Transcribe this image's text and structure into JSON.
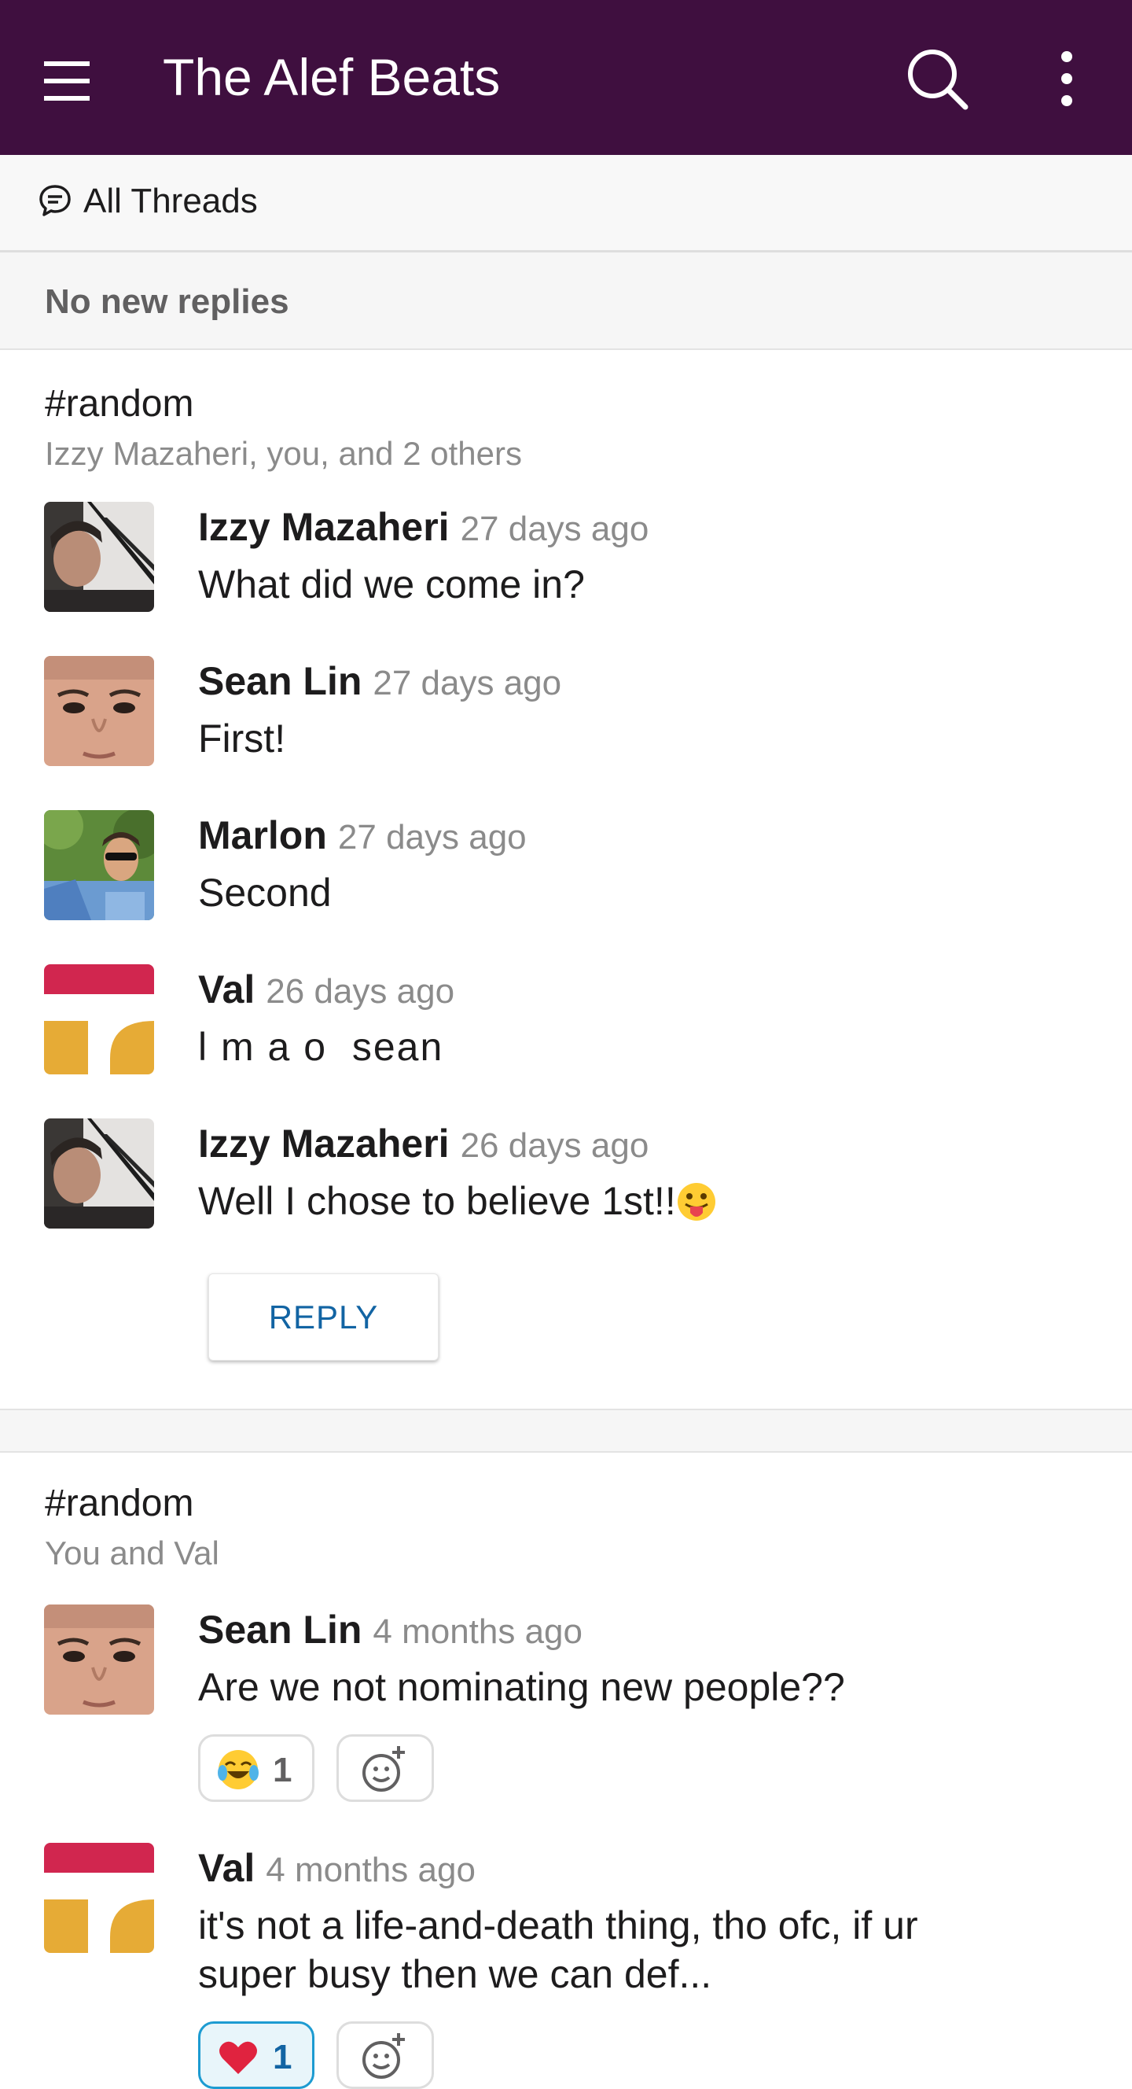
{
  "header": {
    "title": "The Alef Beats",
    "menu_icon": "hamburger-icon",
    "search_icon": "search-icon",
    "more_icon": "more-vertical-icon",
    "background": "#3f0f3f"
  },
  "subheader": {
    "label": "All Threads",
    "icon": "threads-icon"
  },
  "status": {
    "no_replies": "No new replies"
  },
  "threads": [
    {
      "channel": "#random",
      "participants": "Izzy Mazaheri, you, and 2 others",
      "messages": [
        {
          "author": "Izzy Mazaheri",
          "time": "27 days ago",
          "text": "What did we come in?"
        },
        {
          "author": "Sean Lin",
          "time": "27 days ago",
          "text": "First!"
        },
        {
          "author": "Marlon",
          "time": "27 days ago",
          "text": "Second"
        },
        {
          "author": "Val",
          "time": "26 days ago",
          "text": "l m a o  sean"
        },
        {
          "author": "Izzy Mazaheri",
          "time": "26 days ago",
          "text": "Well I chose to believe 1st!!",
          "emoji": "tongue-face-emoji"
        }
      ],
      "reply_label": "REPLY"
    },
    {
      "channel": "#random",
      "participants": "You and Val",
      "messages": [
        {
          "author": "Sean Lin",
          "time": "4 months ago",
          "text": "Are we not nominating new people??",
          "reactions": [
            {
              "emoji": "joy-emoji",
              "count": "1"
            }
          ]
        },
        {
          "author": "Val",
          "time": "4 months ago",
          "text": "it's not a life-and-death thing, tho ofc, if ur super busy then we can def...",
          "reactions": [
            {
              "emoji": "heart-emoji",
              "count": "1"
            }
          ]
        }
      ]
    }
  ],
  "colors": {
    "link": "#1264a3",
    "muted": "#8b8b8b",
    "val_red": "#d1264f",
    "val_yellow": "#e6ab36"
  }
}
